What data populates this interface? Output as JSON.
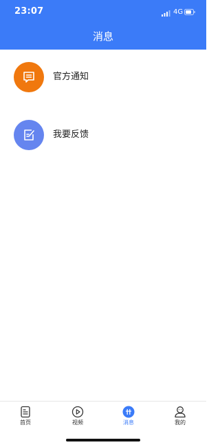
{
  "status_bar": {
    "time": "23:07",
    "network": "4G",
    "signal_icon": "signal-bars-icon",
    "battery_icon": "battery-icon"
  },
  "header": {
    "title": "消息",
    "background": "#3b7bf8"
  },
  "list": {
    "items": [
      {
        "label": "官方通知",
        "icon": "message-icon",
        "color": "#f0780e"
      },
      {
        "label": "我要反馈",
        "icon": "edit-icon",
        "color": "#6585ef"
      }
    ]
  },
  "tabbar": {
    "items": [
      {
        "label": "首页",
        "icon": "document-icon",
        "active": false
      },
      {
        "label": "视频",
        "icon": "play-circle-icon",
        "active": false
      },
      {
        "label": "消息",
        "icon": "chat-hash-icon",
        "active": true
      },
      {
        "label": "我的",
        "icon": "user-icon",
        "active": false
      }
    ],
    "active_color": "#3b7bf8"
  }
}
